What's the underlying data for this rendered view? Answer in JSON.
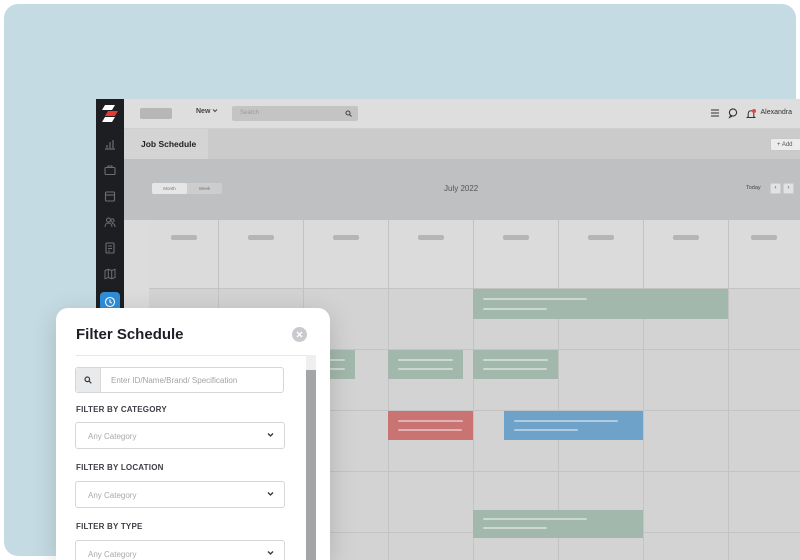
{
  "topbar": {
    "new_label": "New",
    "search_placeholder": "Search",
    "user_name": "Alexandra"
  },
  "page": {
    "title": "Job Schedule",
    "add_label": "Add"
  },
  "calendar": {
    "view_tabs": [
      "Month",
      "Week"
    ],
    "active_tab": "Month",
    "month_label": "July 2022",
    "today_label": "Today",
    "prev_label": "‹",
    "next_label": "›",
    "colors": {
      "green": "#a3b8ac",
      "red": "#c97472",
      "blue": "#6ea2c8"
    }
  },
  "icons": {
    "sidebar": [
      "logo-icon",
      "chart-icon",
      "briefcase-icon",
      "calendar-icon",
      "users-icon",
      "contacts-icon",
      "map-icon",
      "clock-icon"
    ],
    "topbar": [
      "menu-icon",
      "chat-icon",
      "bell-icon",
      "search-icon"
    ]
  },
  "filter": {
    "title": "Filter Schedule",
    "search_placeholder": "Enter ID/Name/Brand/ Specification",
    "category_label": "FILTER BY CATEGORY",
    "category_placeholder": "Any Category",
    "location_label": "FILTER BY LOCATION",
    "location_placeholder": "Any Category",
    "type_label": "FILTER BY TYPE",
    "type_placeholder": "Any Category"
  }
}
